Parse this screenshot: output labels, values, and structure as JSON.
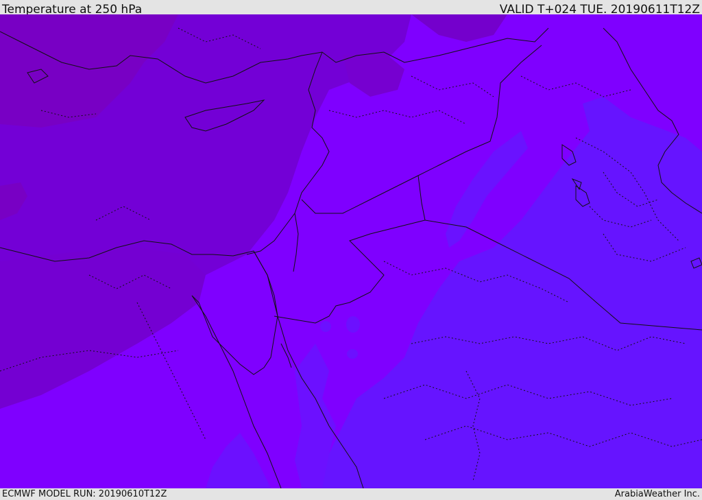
{
  "header": {
    "title": "Temperature at 250 hPa",
    "valid_time": "VALID T+024 TUE. 20190611T12Z"
  },
  "footer": {
    "model_run": "ECMWF MODEL RUN: 20190610T12Z",
    "credit": "ArabiaWeather Inc."
  },
  "map": {
    "colors": {
      "warm_purple": "#7a00c8",
      "dark_purple": "#7000d8",
      "mid_violet": "#8000f2",
      "bright_violet": "#7f00ff",
      "blue_violet": "#6416ff",
      "lighter_blue_violet": "#6a10ff",
      "border_line": "#111111"
    }
  }
}
